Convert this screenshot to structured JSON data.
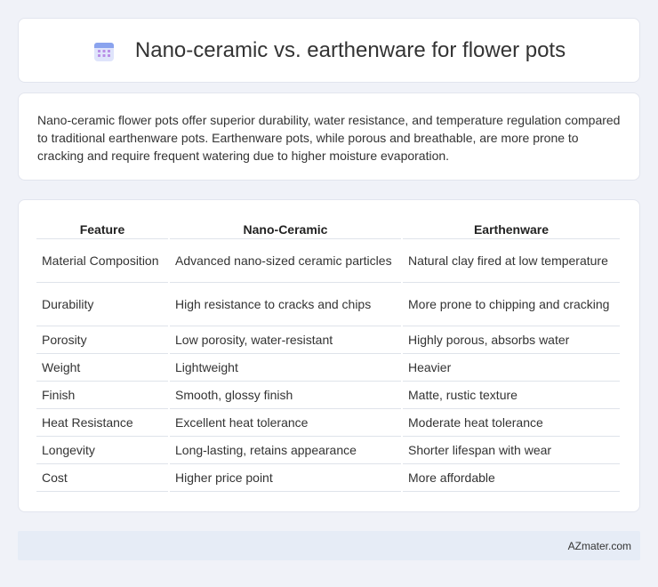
{
  "header": {
    "title": "Nano-ceramic vs. earthenware for flower pots",
    "icon": "calendar-icon"
  },
  "summary": {
    "text": "Nano-ceramic flower pots offer superior durability, water resistance, and temperature regulation compared to traditional earthenware pots. Earthenware pots, while porous and breathable, are more prone to cracking and require frequent watering due to higher moisture evaporation."
  },
  "table": {
    "headers": [
      "Feature",
      "Nano-Ceramic",
      "Earthenware"
    ],
    "rows": [
      [
        "Material Composition",
        "Advanced nano-sized ceramic particles",
        "Natural clay fired at low temperature"
      ],
      [
        "Durability",
        "High resistance to cracks and chips",
        "More prone to chipping and cracking"
      ],
      [
        "Porosity",
        "Low porosity, water-resistant",
        "Highly porous, absorbs water"
      ],
      [
        "Weight",
        "Lightweight",
        "Heavier"
      ],
      [
        "Finish",
        "Smooth, glossy finish",
        "Matte, rustic texture"
      ],
      [
        "Heat Resistance",
        "Excellent heat tolerance",
        "Moderate heat tolerance"
      ],
      [
        "Longevity",
        "Long-lasting, retains appearance",
        "Shorter lifespan with wear"
      ],
      [
        "Cost",
        "Higher price point",
        "More affordable"
      ]
    ]
  },
  "footer": {
    "text": "AZmater.com"
  },
  "colors": {
    "background": "#f0f2f8",
    "card": "#ffffff",
    "footer_bg": "#e6ecf6"
  }
}
